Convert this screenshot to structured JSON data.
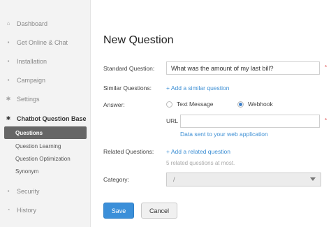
{
  "sidebar": {
    "items": [
      {
        "label": "Dashboard",
        "icon": "home-icon",
        "glyph": "⌂"
      },
      {
        "label": "Get Online & Chat",
        "icon": "chat-icon",
        "glyph": "▪"
      },
      {
        "label": "Installation",
        "icon": "installation-icon",
        "glyph": "▪"
      },
      {
        "label": "Campaign",
        "icon": "campaign-icon",
        "glyph": "▪"
      },
      {
        "label": "Settings",
        "icon": "gear-icon",
        "glyph": "✱"
      },
      {
        "label": "Chatbot Question Base",
        "icon": "bot-icon",
        "glyph": "✱"
      },
      {
        "label": "Security",
        "icon": "lock-icon",
        "glyph": "▪"
      },
      {
        "label": "History",
        "icon": "history-icon",
        "glyph": "◔"
      }
    ],
    "sub_items": [
      {
        "label": "Questions"
      },
      {
        "label": "Question Learning"
      },
      {
        "label": "Question Optimization"
      },
      {
        "label": "Synonym"
      }
    ]
  },
  "main": {
    "title": "New Question",
    "standard_question": {
      "label": "Standard Question:",
      "value": "What was the amount of my last bill?",
      "required": "*"
    },
    "similar_questions": {
      "label": "Similar Questions:",
      "add_link": "+ Add a similar question"
    },
    "answer": {
      "label": "Answer:",
      "options": [
        {
          "label": "Text Message",
          "checked": false
        },
        {
          "label": "Webhook",
          "checked": true
        }
      ],
      "url_label": "URL",
      "url_value": "",
      "url_hint": "Data sent to your web application",
      "required": "*"
    },
    "related_questions": {
      "label": "Related Questions:",
      "add_link": "+ Add a related question",
      "hint": "5 related questions at most."
    },
    "category": {
      "label": "Category:",
      "value": "/"
    },
    "buttons": {
      "save": "Save",
      "cancel": "Cancel"
    }
  },
  "colors": {
    "accent": "#3b8fd9",
    "link": "#3d8fd4",
    "sidebar_active": "#666666",
    "required": "#e05050"
  }
}
